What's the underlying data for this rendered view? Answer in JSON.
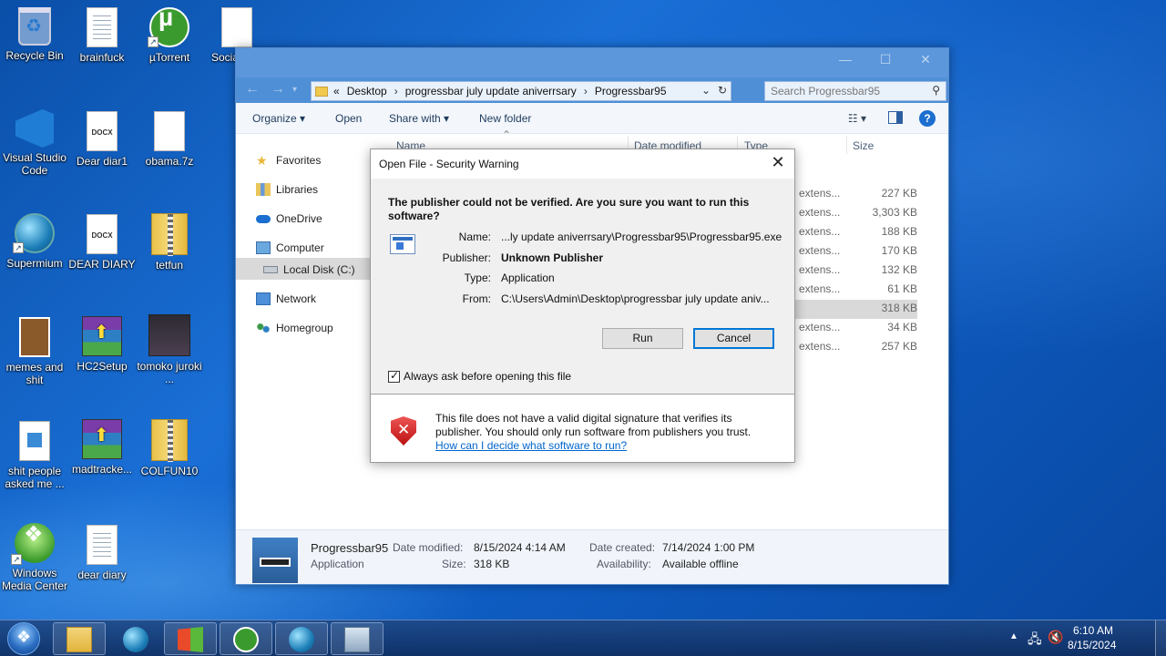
{
  "desktop_icons": [
    {
      "id": "recycle-bin",
      "label": "Recycle Bin"
    },
    {
      "id": "brainfuck",
      "label": "brainfuck"
    },
    {
      "id": "utorrent",
      "label": "µTorrent"
    },
    {
      "id": "social",
      "label": "Social... ..."
    },
    {
      "id": "vscode",
      "label": "Visual Studio Code"
    },
    {
      "id": "dear-diar1",
      "label": "Dear diar1"
    },
    {
      "id": "obama",
      "label": "obama.7z"
    },
    {
      "id": "supermium",
      "label": "Supermium"
    },
    {
      "id": "dear-diary-docx",
      "label": "DEAR DIARY"
    },
    {
      "id": "tetfun",
      "label": "tetfun"
    },
    {
      "id": "memes",
      "label": "memes and shit"
    },
    {
      "id": "hc2setup",
      "label": "HC2Setup"
    },
    {
      "id": "tomoko",
      "label": "tomoko juroki ..."
    },
    {
      "id": "shit-people",
      "label": "shit people asked me ..."
    },
    {
      "id": "madtracker",
      "label": "madtracke..."
    },
    {
      "id": "colfun10",
      "label": "COLFUN10"
    },
    {
      "id": "wmc",
      "label": "Windows Media Center"
    },
    {
      "id": "dear-diary-doc",
      "label": "dear diary"
    }
  ],
  "docx_badge": "DOCX",
  "explorer": {
    "address": {
      "prefix": "«",
      "crumbs": [
        "Desktop",
        "progressbar july update aniverrsary",
        "Progressbar95"
      ]
    },
    "search_placeholder": "Search Progressbar95",
    "toolbar": {
      "organize": "Organize ▾",
      "open": "Open",
      "share_with": "Share with ▾",
      "new_folder": "New folder"
    },
    "nav": [
      {
        "label": "Favorites"
      },
      {
        "label": "Libraries"
      },
      {
        "label": "OneDrive"
      },
      {
        "label": "Computer"
      },
      {
        "label": "Local Disk (C:)"
      },
      {
        "label": "Network"
      },
      {
        "label": "Homegroup"
      }
    ],
    "columns": {
      "name": "Name",
      "date_modified": "Date modified",
      "type": "Type",
      "size": "Size"
    },
    "rows": [
      {
        "type": "n extens...",
        "size": "227 KB"
      },
      {
        "type": "n extens...",
        "size": "3,303 KB"
      },
      {
        "type": "n extens...",
        "size": "188 KB"
      },
      {
        "type": "n extens...",
        "size": "170 KB"
      },
      {
        "type": "n extens...",
        "size": "132 KB"
      },
      {
        "type": "n extens...",
        "size": "61 KB"
      },
      {
        "type": "n",
        "size": "318 KB"
      },
      {
        "type": "n extens...",
        "size": "34 KB"
      },
      {
        "type": "n extens...",
        "size": "257 KB"
      }
    ],
    "details": {
      "name": "Progressbar95",
      "kind": "Application",
      "date_modified_label": "Date modified:",
      "date_modified": "8/15/2024 4:14 AM",
      "size_label": "Size:",
      "size": "318 KB",
      "date_created_label": "Date created:",
      "date_created": "7/14/2024 1:00 PM",
      "availability_label": "Availability:",
      "availability": "Available offline"
    }
  },
  "dialog": {
    "title": "Open File - Security Warning",
    "question": "The publisher could not be verified.  Are you sure you want to run this software?",
    "name_label": "Name:",
    "name_value": "...ly update aniverrsary\\Progressbar95\\Progressbar95.exe",
    "publisher_label": "Publisher:",
    "publisher_value": "Unknown Publisher",
    "type_label": "Type:",
    "type_value": "Application",
    "from_label": "From:",
    "from_value": "C:\\Users\\Admin\\Desktop\\progressbar july update aniv...",
    "run_label": "Run",
    "cancel_label": "Cancel",
    "checkbox_label": "Always ask before opening this file",
    "checkbox_checked": true,
    "warning_text": "This file does not have a valid digital signature that verifies its publisher.  You should only run software from publishers you trust.",
    "help_link": "How can I decide what software to run?"
  },
  "taskbar": {
    "time": "6:10 AM",
    "date": "8/15/2024"
  }
}
